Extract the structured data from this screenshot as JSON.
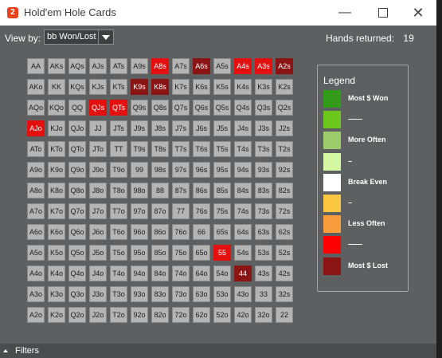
{
  "window": {
    "title": "Hold'em Hole Cards",
    "icon_text": "2"
  },
  "toolbar": {
    "view_by_label": "View by:",
    "view_by_value": "bb Won/Lost",
    "hands_label": "Hands returned:",
    "hands_count": "19"
  },
  "grid": {
    "rows": [
      [
        "AA",
        "AKs",
        "AQs",
        "AJs",
        "ATs",
        "A9s",
        "A8s",
        "A7s",
        "A6s",
        "A5s",
        "A4s",
        "A3s",
        "A2s"
      ],
      [
        "AKo",
        "KK",
        "KQs",
        "KJs",
        "KTs",
        "K9s",
        "K8s",
        "K7s",
        "K6s",
        "K5s",
        "K4s",
        "K3s",
        "K2s"
      ],
      [
        "AQo",
        "KQo",
        "QQ",
        "QJs",
        "QTs",
        "Q9s",
        "Q8s",
        "Q7s",
        "Q6s",
        "Q5s",
        "Q4s",
        "Q3s",
        "Q2s"
      ],
      [
        "AJo",
        "KJo",
        "QJo",
        "JJ",
        "JTs",
        "J9s",
        "J8s",
        "J7s",
        "J6s",
        "J5s",
        "J4s",
        "J3s",
        "J2s"
      ],
      [
        "ATo",
        "KTo",
        "QTo",
        "JTo",
        "TT",
        "T9s",
        "T8s",
        "T7s",
        "T6s",
        "T5s",
        "T4s",
        "T3s",
        "T2s"
      ],
      [
        "A9o",
        "K9o",
        "Q9o",
        "J9o",
        "T9o",
        "99",
        "98s",
        "97s",
        "96s",
        "95s",
        "94s",
        "93s",
        "92s"
      ],
      [
        "A8o",
        "K8o",
        "Q8o",
        "J8o",
        "T8o",
        "98o",
        "88",
        "87s",
        "86s",
        "85s",
        "84s",
        "83s",
        "82s"
      ],
      [
        "A7o",
        "K7o",
        "Q7o",
        "J7o",
        "T7o",
        "97o",
        "87o",
        "77",
        "76s",
        "75s",
        "74s",
        "73s",
        "72s"
      ],
      [
        "A6o",
        "K6o",
        "Q6o",
        "J6o",
        "T6o",
        "96o",
        "86o",
        "76o",
        "66",
        "65s",
        "64s",
        "63s",
        "62s"
      ],
      [
        "A5o",
        "K5o",
        "Q5o",
        "J5o",
        "T5o",
        "95o",
        "85o",
        "75o",
        "65o",
        "55",
        "54s",
        "53s",
        "52s"
      ],
      [
        "A4o",
        "K4o",
        "Q4o",
        "J4o",
        "T4o",
        "94o",
        "84o",
        "74o",
        "64o",
        "54o",
        "44",
        "43s",
        "42s"
      ],
      [
        "A3o",
        "K3o",
        "Q3o",
        "J3o",
        "T3o",
        "93o",
        "83o",
        "73o",
        "63o",
        "53o",
        "43o",
        "33",
        "32s"
      ],
      [
        "A2o",
        "K2o",
        "Q2o",
        "J2o",
        "T2o",
        "92o",
        "82o",
        "72o",
        "62o",
        "52o",
        "42o",
        "32o",
        "22"
      ]
    ],
    "highlights": {
      "A8s": "lost",
      "A6s": "lost-most",
      "A4s": "lost",
      "A3s": "lost",
      "A2s": "lost-most",
      "K9s": "lost-most",
      "K8s": "lost-most",
      "QJs": "lost",
      "QTs": "lost",
      "AJo": "lost",
      "55": "lost",
      "44": "lost-most"
    }
  },
  "legend": {
    "title": "Legend",
    "items": [
      {
        "label": "Most $ Won",
        "color": "#329b19"
      },
      {
        "label": "——",
        "color": "#6cc61c"
      },
      {
        "label": "More Often",
        "color": "#9ccb6c"
      },
      {
        "label": "–",
        "color": "#d4f7a4"
      },
      {
        "label": "Break Even",
        "color": "#ffffff"
      },
      {
        "label": "–",
        "color": "#fcc841"
      },
      {
        "label": "Less Often",
        "color": "#f89c3c"
      },
      {
        "label": "——",
        "color": "#ff0000"
      },
      {
        "label": "Most $ Lost",
        "color": "#8b1414"
      }
    ]
  },
  "footer": {
    "filters_label": "Filters"
  }
}
